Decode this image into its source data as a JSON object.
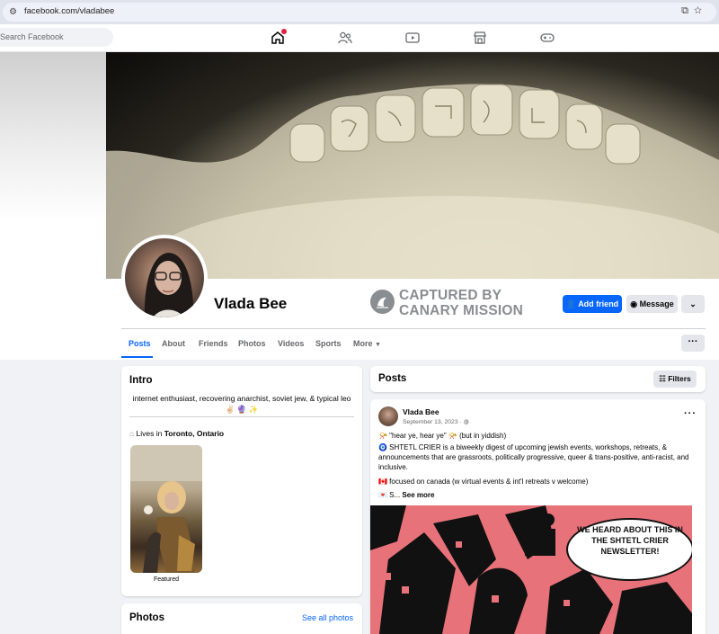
{
  "browser": {
    "url": "facebook.com/vladabee",
    "icons": [
      "site-settings-icon",
      "install-icon",
      "bookmark-star-icon"
    ]
  },
  "topnav": {
    "search_placeholder": "Search Facebook",
    "icons": [
      "home-icon",
      "friends-icon",
      "video-icon",
      "marketplace-icon",
      "gaming-icon"
    ]
  },
  "profile": {
    "name": "Vlada Bee",
    "overlay_text_line1": "CAPTURED BY",
    "overlay_text_line2": "CANARY MISSION",
    "add_friend_label": "Add friend",
    "message_label": "Message"
  },
  "tabs": [
    "Posts",
    "About",
    "Friends",
    "Photos",
    "Videos",
    "Sports",
    "More"
  ],
  "active_tab": "Posts",
  "intro": {
    "title": "Intro",
    "bio_line1": "internet enthusiast, recovering anarchist, soviet jew, & typical leo",
    "bio_line2": "✌🏻 🔮 ✨",
    "lives_prefix": "Lives in ",
    "lives_place": "Toronto, Ontario",
    "featured_label": "Featured"
  },
  "photos": {
    "title": "Photos",
    "see_all": "See all photos"
  },
  "posts": {
    "title": "Posts",
    "filters_label": "Filters",
    "post": {
      "author": "Vlada Bee",
      "date": "September 13, 2023 ·",
      "line1": "📯 \"hear ye, hear ye\" 📯 (but in yiddish)",
      "line2": "🧿 SHTETL CRIER is a biweekly digest of upcoming jewish events, workshops, retreats, & announcements that are grassroots, politically progressive, queer & trans-positive, anti-racist, and inclusive.",
      "line3": "🇨🇦 focused on canada (w virtual events & int'l retreats v welcome)",
      "line4_prefix": "💌 S... ",
      "see_more": "See more",
      "image_text": "WE HEARD ABOUT THIS IN THE SHTETL CRIER NEWSLETTER!"
    }
  },
  "colors": {
    "accent": "#0866ff",
    "page_bg": "#f0f2f5",
    "poster_bg": "#e8727a"
  }
}
